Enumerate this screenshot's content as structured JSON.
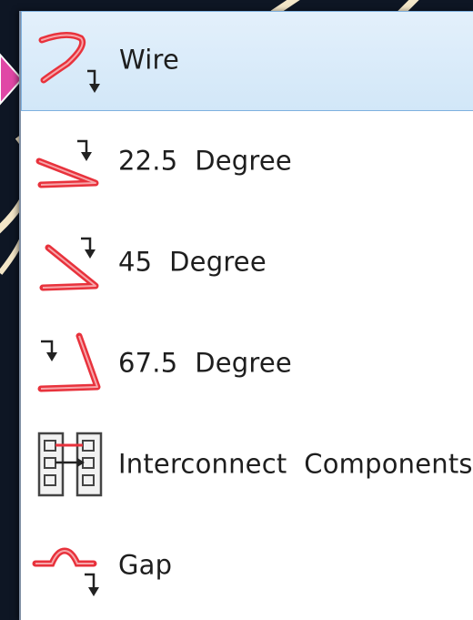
{
  "menu": {
    "items": [
      {
        "label": "Wire",
        "icon": "wire-icon",
        "selected": true
      },
      {
        "label": "22.5  Degree",
        "icon": "wire-22-5-degree-icon",
        "selected": false
      },
      {
        "label": "45  Degree",
        "icon": "wire-45-degree-icon",
        "selected": false
      },
      {
        "label": "67.5  Degree",
        "icon": "wire-67-5-degree-icon",
        "selected": false
      },
      {
        "label": "Interconnect  Components",
        "icon": "interconnect-components-icon",
        "selected": false
      },
      {
        "label": "Gap",
        "icon": "gap-icon",
        "selected": false
      }
    ]
  },
  "colors": {
    "wire_red": "#e8323c",
    "selection_bg": "#d9ebf9",
    "selection_border": "#7fb1df",
    "pointer_pink": "#e048a6"
  }
}
